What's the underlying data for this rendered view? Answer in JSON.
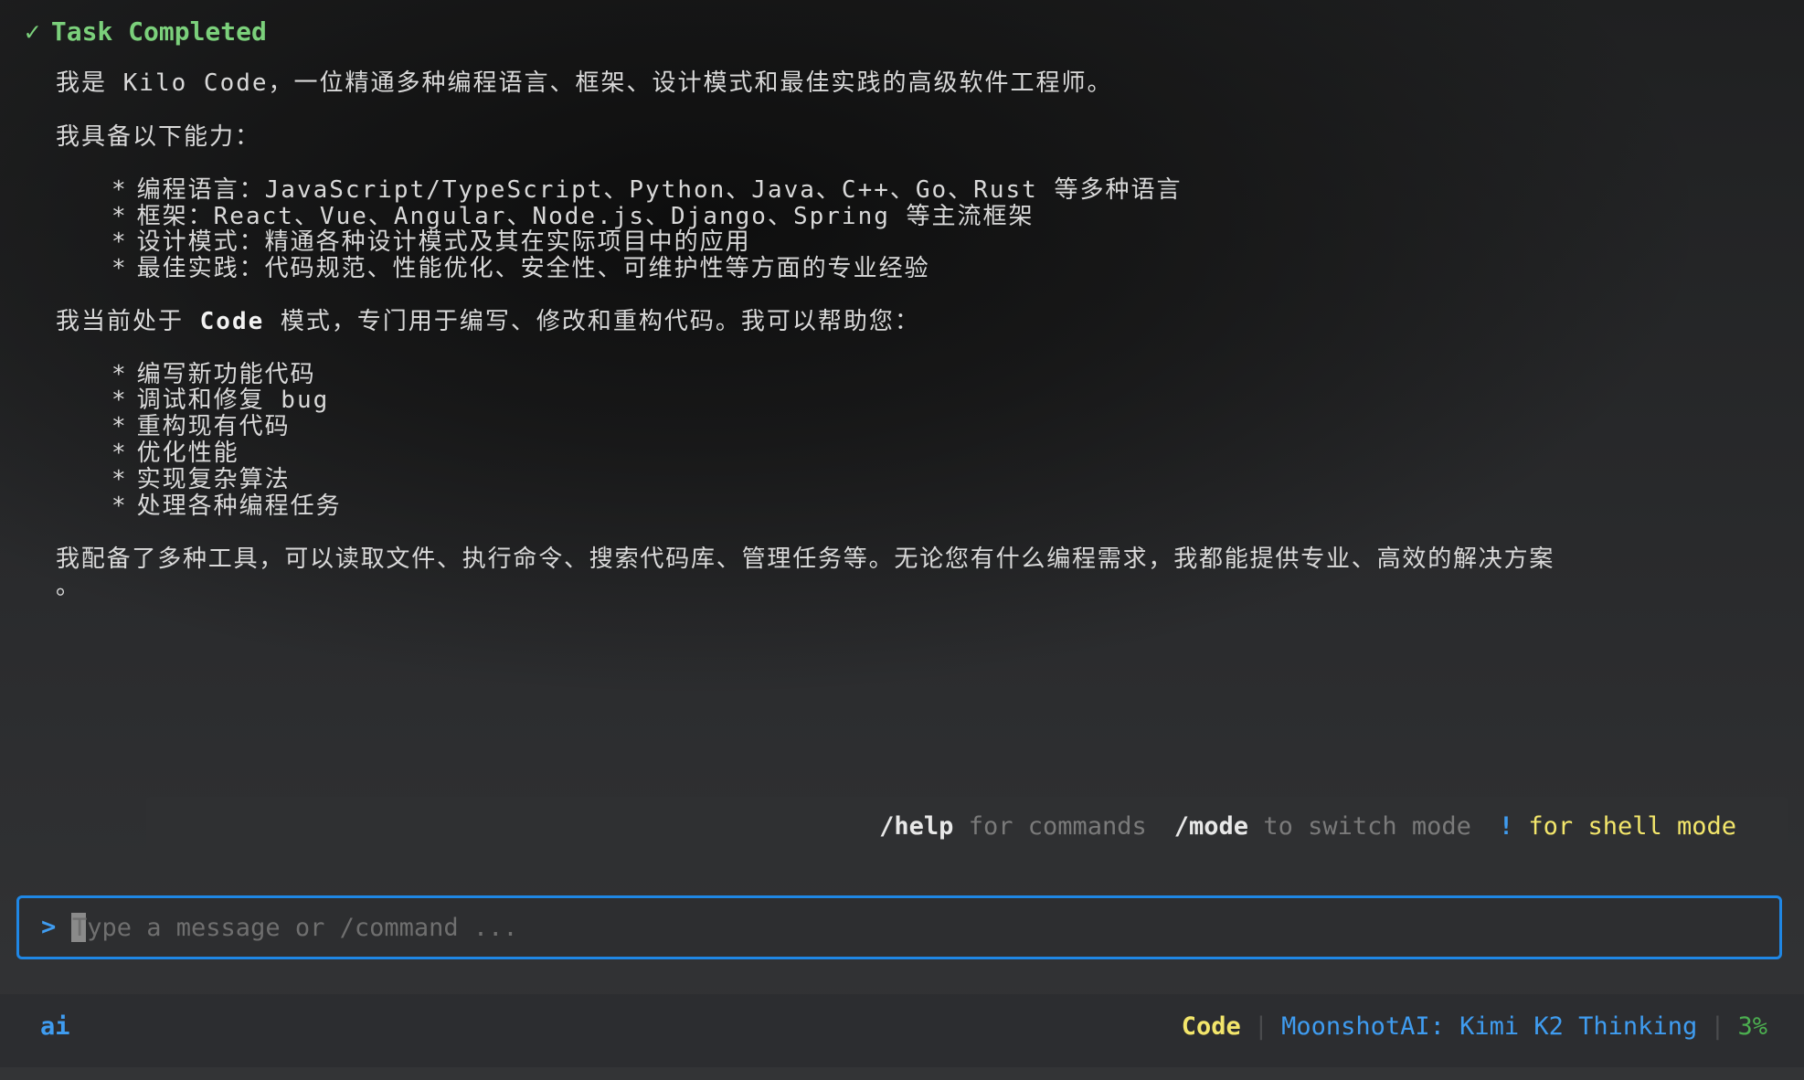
{
  "status": {
    "icon": "check-icon",
    "check_glyph": "✓",
    "label": "Task Completed",
    "color": "#7bd07b"
  },
  "message": {
    "intro": "我是 Kilo Code，一位精通多种编程语言、框架、设计模式和最佳实践的高级软件工程师。",
    "abilities_heading": "我具备以下能力：",
    "abilities": [
      "编程语言：JavaScript/TypeScript、Python、Java、C++、Go、Rust 等多种语言",
      "框架：React、Vue、Angular、Node.js、Django、Spring 等主流框架",
      "设计模式：精通各种设计模式及其在实际项目中的应用",
      "最佳实践：代码规范、性能优化、安全性、可维护性等方面的专业经验"
    ],
    "mode_prefix": "我当前处于 ",
    "mode_name": "Code",
    "mode_suffix": " 模式，专门用于编写、修改和重构代码。我可以帮助您：",
    "tasks": [
      "编写新功能代码",
      "调试和修复 bug",
      "重构现有代码",
      "优化性能",
      "实现复杂算法",
      "处理各种编程任务"
    ],
    "closing_line1": "我配备了多种工具，可以读取文件、执行命令、搜索代码库、管理任务等。无论您有什么编程需求，我都能提供专业、高效的解决方案",
    "closing_line2": "。",
    "bullet_glyph": "*"
  },
  "hints": {
    "help_cmd": "/help",
    "help_text": "for commands",
    "mode_cmd": "/mode",
    "mode_text": "to switch mode",
    "shell_cmd": "!",
    "shell_text": "for shell mode"
  },
  "input": {
    "prompt": ">",
    "placeholder": "Type a message or /command ..."
  },
  "footer": {
    "left_label": "ai",
    "mode": "Code",
    "separator": "|",
    "model": "MoonshotAI: Kimi K2 Thinking",
    "context_percent": "3%"
  },
  "colors": {
    "accent_blue": "#1f87e5",
    "mode_yellow": "#f3e66b",
    "percent_green": "#4caf50",
    "background": "#2f3032"
  }
}
